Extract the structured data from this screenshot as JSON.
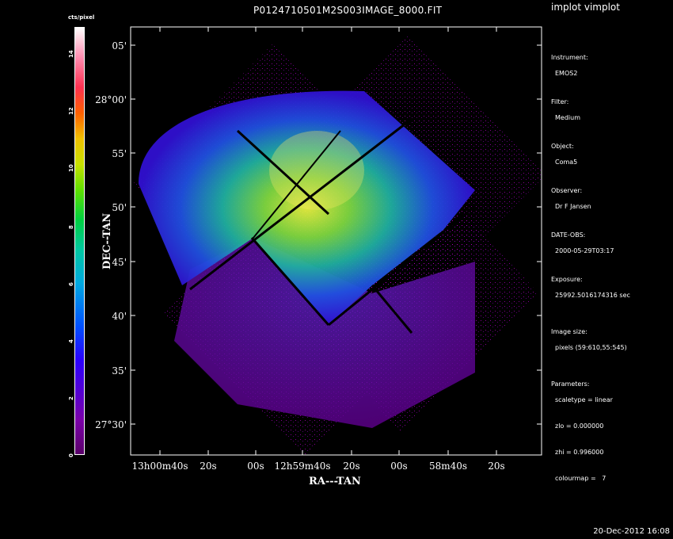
{
  "header": {
    "title": "P0124710501M2S003IMAGE_8000.FIT",
    "app_title": "implot vimplot"
  },
  "colorbar": {
    "label": "cts/pixel",
    "ticks": [
      "0",
      "2",
      "4",
      "6",
      "8",
      "10",
      "12",
      "14"
    ]
  },
  "chart_data": {
    "type": "heatmap",
    "title": "P0124710501M2S003IMAGE_8000.FIT",
    "xlabel": "RA---TAN",
    "ylabel": "DEC--TAN",
    "x_ticks": [
      "13h00m40s",
      "20s",
      "00s",
      "12h59m40s",
      "20s",
      "00s",
      "58m40s",
      "20s"
    ],
    "y_ticks": [
      "05'",
      "28°00'",
      "55'",
      "50'",
      "45'",
      "40'",
      "35'",
      "27°30'"
    ],
    "colorbar_range": [
      0,
      15
    ],
    "colorbar_unit": "cts/pixel",
    "colormap": "7"
  },
  "info": {
    "instrument_label": "Instrument:",
    "instrument": "EMOS2",
    "filter_label": "Filter:",
    "filter": "Medium",
    "object_label": "Object:",
    "object": "Coma5",
    "observer_label": "Observer:",
    "observer": "Dr F Jansen",
    "date_label": "DATE-OBS:",
    "date": "2000-05-29T03:17",
    "exposure_label": "Exposure:",
    "exposure": "25992.5016174316 sec",
    "size_label": "Image size:",
    "size": "pixels (59:610,55:545)",
    "params_label": "Parameters:",
    "p1": "scaletype = linear",
    "p2": "zlo = 0.000000",
    "p3": "zhi = 0.996000",
    "p4": "colourmap =   7"
  },
  "footer": {
    "timestamp": "20-Dec-2012 16:08"
  }
}
